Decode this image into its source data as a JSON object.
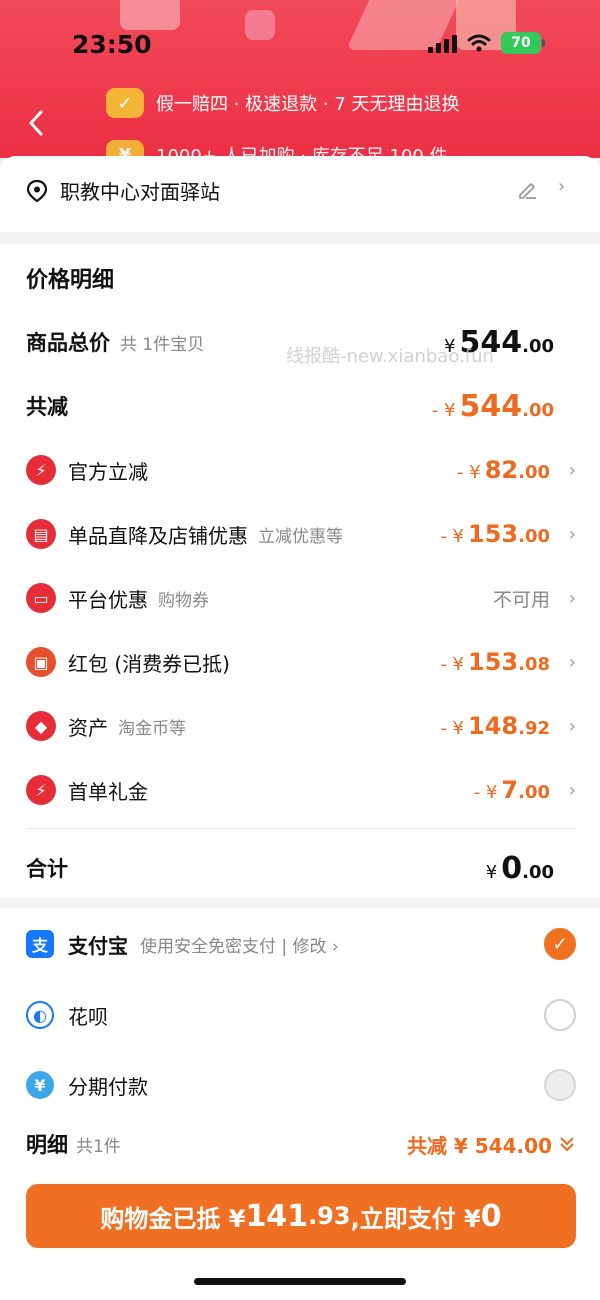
{
  "status": {
    "time": "23:50",
    "battery": "70"
  },
  "header": {
    "guarantee_text": "假一赔四 · 极速退款 · 7 天无理由退换",
    "guarantee_text_2": "1000+ 人已加购 · 库存不足 100 件"
  },
  "address": {
    "label": "职教中心对面驿站"
  },
  "price": {
    "title": "价格明细",
    "total_label": "商品总价",
    "total_sub": "共 1件宝贝",
    "total_sign": "¥",
    "total_int": "544",
    "total_dec": ".00",
    "reduce_label": "共减",
    "reduce_sign": "- ¥",
    "reduce_int": "544",
    "reduce_dec": ".00",
    "items": [
      {
        "label": "官方立减",
        "sub": "",
        "sign": "- ¥",
        "int": "82",
        "dec": ".00",
        "icon": "lightning-icon"
      },
      {
        "label": "单品直降及店铺优惠",
        "sub": "立减优惠等",
        "sign": "- ¥",
        "int": "153",
        "dec": ".00",
        "icon": "store-icon"
      },
      {
        "label": "平台优惠",
        "sub": "购物券",
        "text": "不可用",
        "icon": "ticket-icon"
      },
      {
        "label": "红包 (消费券已抵)",
        "sub": "",
        "sign": "- ¥",
        "int": "153",
        "dec": ".08",
        "icon": "red-packet-icon"
      },
      {
        "label": "资产",
        "sub": "淘金币等",
        "sign": "- ¥",
        "int": "148",
        "dec": ".92",
        "icon": "tag-icon"
      },
      {
        "label": "首单礼金",
        "sub": "",
        "sign": "- ¥",
        "int": "7",
        "dec": ".00",
        "icon": "lightning-icon"
      }
    ],
    "sum_label": "合计",
    "sum_sign": "¥",
    "sum_int": "0",
    "sum_dec": ".00"
  },
  "payment": {
    "options": [
      {
        "name": "支付宝",
        "sub": "使用安全免密支付 | 修改 ›",
        "selected": true
      },
      {
        "name": "花呗",
        "sub": "",
        "selected": false
      },
      {
        "name": "分期付款",
        "sub": "",
        "selected": false
      }
    ]
  },
  "summary": {
    "title": "明细",
    "sub": "共1件",
    "right": "共减 ¥ 544.00"
  },
  "pay_button": {
    "prefix": "购物金已抵 ¥ ",
    "amount1": "141",
    "amount1_dec": ".93",
    "middle": ",立即支付 ¥ ",
    "amount2": "0"
  },
  "watermark": "线报酷-new.xianbao.fun",
  "colors": {
    "accent": "#ef6f23",
    "header": "#ee3a4c",
    "red_icon": "#e72e38"
  }
}
